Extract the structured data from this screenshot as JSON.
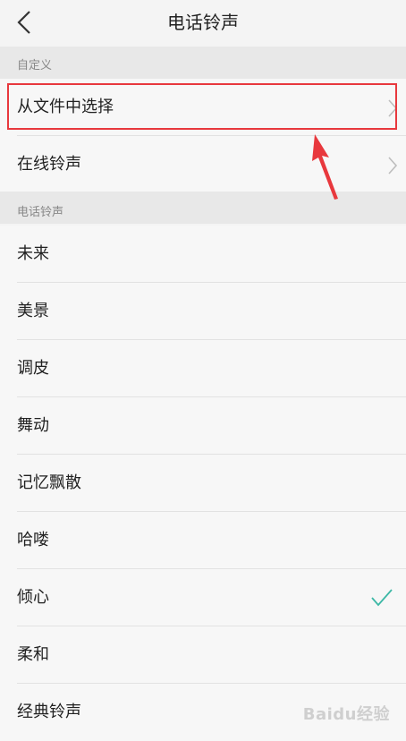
{
  "header": {
    "title": "电话铃声",
    "back_icon": "chevron-left-icon"
  },
  "custom_section": {
    "header": "自定义",
    "items": [
      {
        "label": "从文件中选择",
        "icon": "chevron-right-icon"
      },
      {
        "label": "在线铃声",
        "icon": "chevron-right-icon"
      }
    ]
  },
  "ringtone_section": {
    "header": "电话铃声",
    "items": [
      {
        "label": "未来",
        "selected": false
      },
      {
        "label": "美景",
        "selected": false
      },
      {
        "label": "调皮",
        "selected": false
      },
      {
        "label": "舞动",
        "selected": false
      },
      {
        "label": "记忆飘散",
        "selected": false
      },
      {
        "label": "哈喽",
        "selected": false
      },
      {
        "label": "倾心",
        "selected": true
      },
      {
        "label": "柔和",
        "selected": false
      },
      {
        "label": "经典铃声",
        "selected": false
      }
    ]
  },
  "annotation": {
    "highlight_color": "#e8383d"
  },
  "watermark": {
    "text": "Baidu经验"
  },
  "colors": {
    "accent_check": "#3db8a6",
    "background": "#f4f4f4",
    "section_header_bg": "#e8e8e8"
  }
}
